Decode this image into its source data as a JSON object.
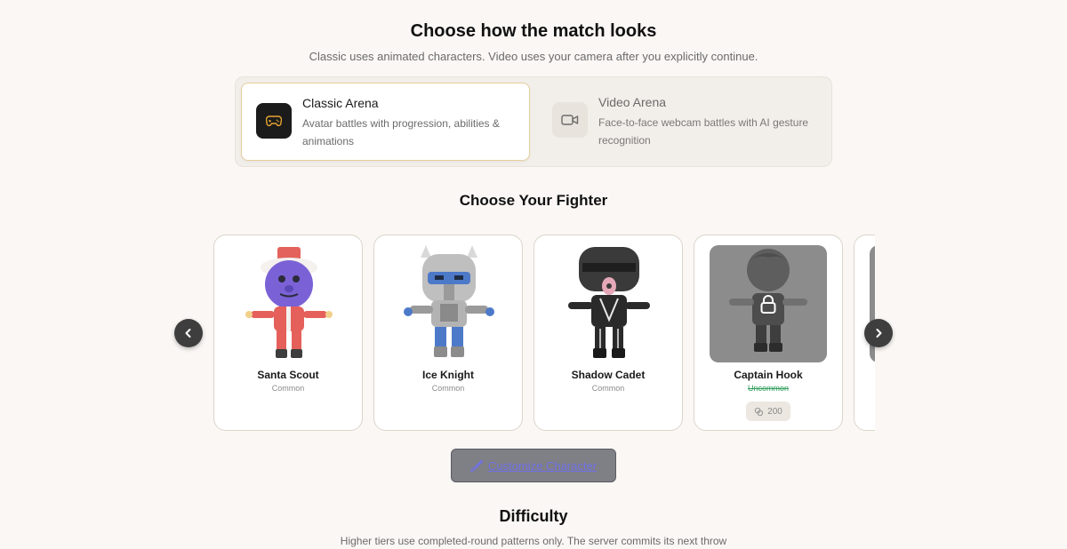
{
  "header": {
    "title": "Choose how the match looks",
    "subtitle": "Classic uses animated characters. Video uses your camera after you explicitly continue."
  },
  "modes": [
    {
      "name": "Classic Arena",
      "description": "Avatar battles with progression, abilities & animations",
      "icon": "gamepad-icon",
      "selected": true
    },
    {
      "name": "Video Arena",
      "description": "Face-to-face webcam battles with AI gesture recognition",
      "icon": "video-camera-icon",
      "selected": false
    }
  ],
  "fighter_section": {
    "title": "Choose Your Fighter",
    "fighters": [
      {
        "name": "Santa Scout",
        "rarity": "Common",
        "locked": false
      },
      {
        "name": "Ice Knight",
        "rarity": "Common",
        "locked": false
      },
      {
        "name": "Shadow Cadet",
        "rarity": "Common",
        "locked": false
      },
      {
        "name": "Captain Hook",
        "rarity": "Uncommon",
        "locked": true,
        "price": "200"
      }
    ],
    "customize_label": "Customize Character"
  },
  "difficulty": {
    "title": "Difficulty",
    "subtitle": "Higher tiers use completed-round patterns only. The server commits its next throw"
  },
  "colors": {
    "background": "#faf7f4",
    "accent_gold": "#e7a531",
    "uncommon_green": "#2e9d5a",
    "link_purple": "#6f70e6"
  }
}
